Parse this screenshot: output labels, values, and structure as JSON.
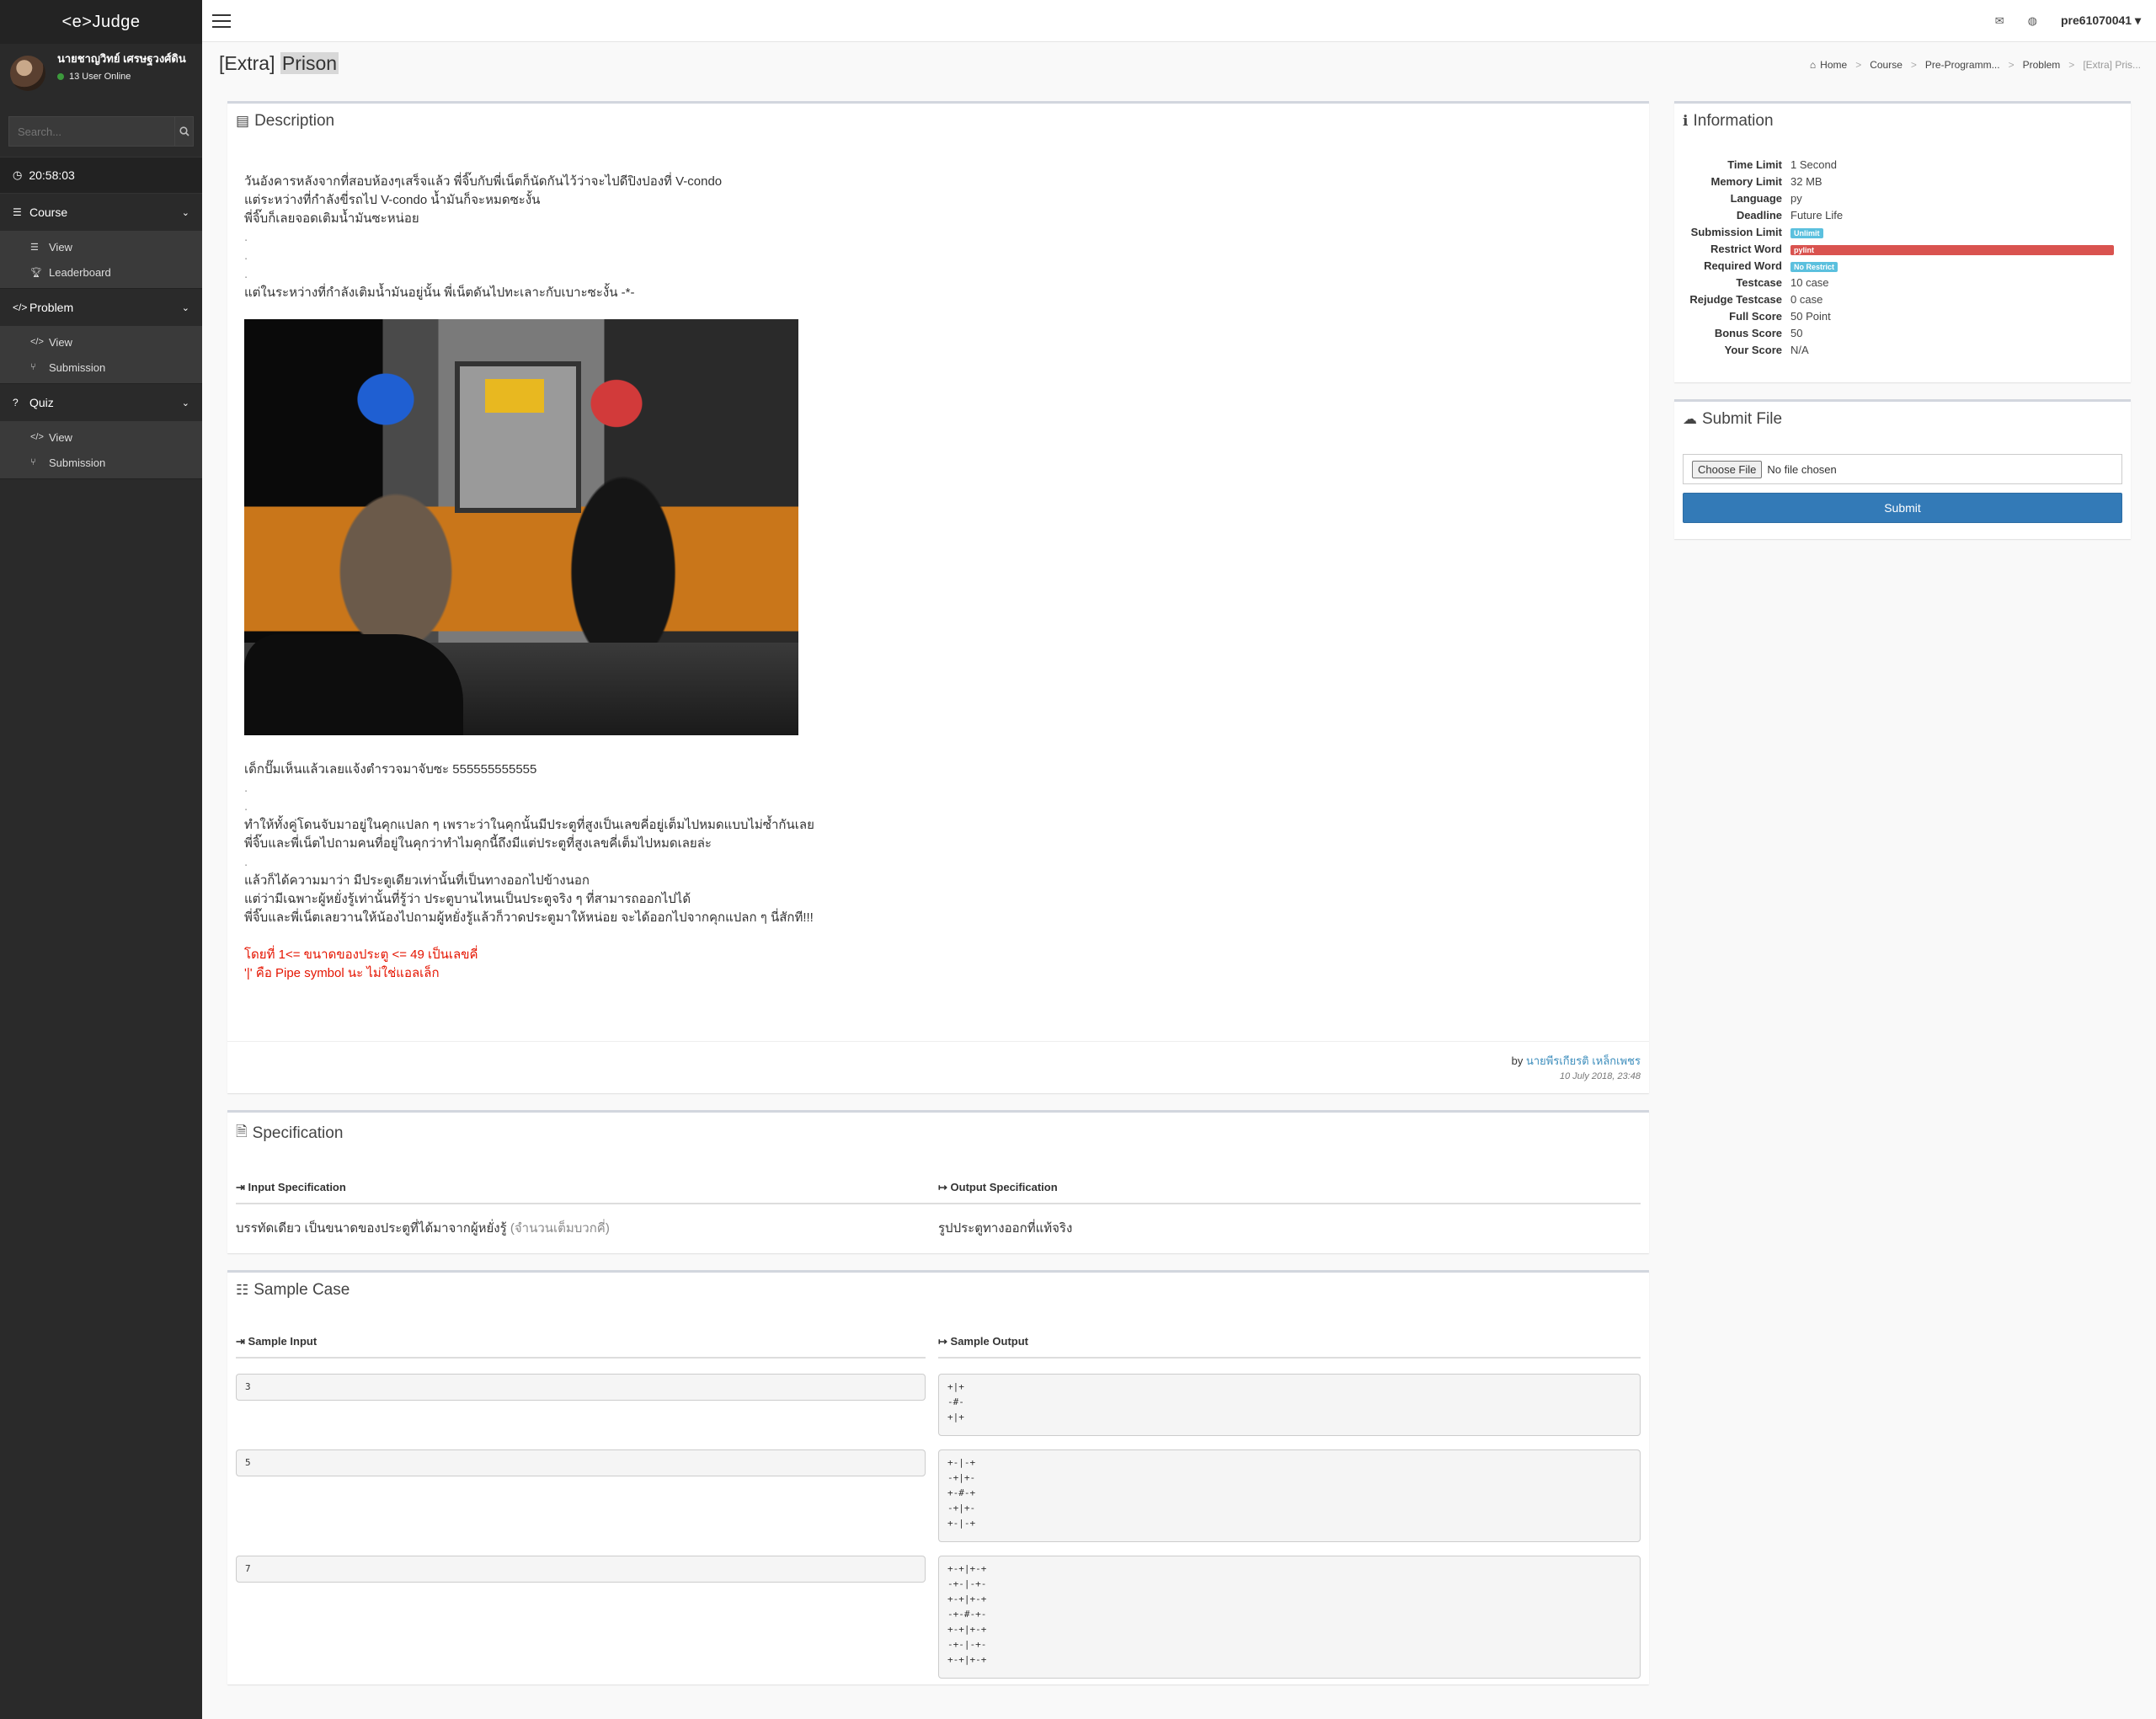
{
  "brand": "<e>Judge",
  "user": {
    "name": "นายชาญวิทย์ เศรษฐวงศ์ดิน",
    "online": "13 User Online"
  },
  "search": {
    "placeholder": "Search..."
  },
  "clock": "20:58:03",
  "menu": {
    "course": {
      "label": "Course",
      "items": [
        "View",
        "Leaderboard"
      ]
    },
    "problem": {
      "label": "Problem",
      "items": [
        "View",
        "Submission"
      ]
    },
    "quiz": {
      "label": "Quiz",
      "items": [
        "View",
        "Submission"
      ]
    }
  },
  "topbar": {
    "username": "pre61070041"
  },
  "page": {
    "title_prefix": "[Extra]",
    "title_main": "Prison"
  },
  "breadcrumb": [
    "Home",
    "Course",
    "Pre-Programm...",
    "Problem",
    "[Extra] Pris..."
  ],
  "description": {
    "title": "Description",
    "lines1": [
      "วันอังคารหลังจากที่สอบห้องๆเสร็จแล้ว พี่จิ๊บกับพี่เน็ตก็นัดกันไว้ว่าจะไปดีปิงปองที่ V-condo",
      "แต่ระหว่างที่กำลังขี่รถไป V-condo น้ำมันก็จะหมดซะงั้น",
      "พี่จิ๊บก็เลยจอดเติมน้ำมันซะหน่อย"
    ],
    "line2": "แต่ในระหว่างที่กำลังเติมน้ำมันอยู่นั้น   พี่เน็ตดันไปทะเลาะกับเบาะซะงั้น -*-",
    "line3": "เด็กปั๊มเห็นแล้วเลยแจ้งตำรวจมาจับซะ 555555555555",
    "lines4": [
      "ทำให้ทั้งคู่โดนจับมาอยู่ในคุกแปลก ๆ เพราะว่าในคุกนั้นมีประตูที่สูงเป็นเลขคี่อยู่เต็มไปหมดแบบไม่ซ้ำกันเลย",
      "พี่จิ๊บและพี่เน็ตไปถามคนที่อยู่ในคุกว่าทำไมคุกนี้ถึงมีแต่ประตูที่สูงเลขคี่เต็มไปหมดเลยล่ะ"
    ],
    "lines5": [
      "แล้วก็ได้ความมาว่า มีประตูเดียวเท่านั้นที่เป็นทางออกไปข้างนอก",
      "แต่ว่ามีเฉพาะผู้หยั่งรู้เท่านั้นที่รู้ว่า ประตูบานไหนเป็นประตูจริง ๆ ที่สามารถออกไปได้",
      "พี่จิ๊บและพี่เน็ตเลยวานให้น้องไปถามผู้หยั่งรู้แล้วก็วาดประตูมาให้หน่อย จะได้ออกไปจากคุกแปลก ๆ นี่สักที!!!"
    ],
    "red1": "โดยที่  1<= ขนาดของประตู <= 49  เป็นเลขคี่",
    "red2": "'|'  คือ  Pipe symbol นะ  ไม่ใช่แอลเล็ก",
    "by_prefix": "by",
    "author": "นายพีรเกียรติ เหล็กเพชร",
    "date": "10 July 2018, 23:48"
  },
  "specification": {
    "title": "Specification",
    "input_head": "Input Specification",
    "output_head": "Output Specification",
    "input_text": "บรรทัดเดียว เป็นขนาดของประตูที่ได้มาจากผู้หยั่งรู้",
    "input_note": "(จำนวนเต็มบวกคี่)",
    "output_text": "รูปประตูทางออกที่แท้จริง"
  },
  "sample": {
    "title": "Sample Case",
    "input_head": "Sample Input",
    "output_head": "Sample Output",
    "cases": [
      {
        "input": "3",
        "output": "+|+\n-#-\n+|+"
      },
      {
        "input": "5",
        "output": "+-|-+\n-+|+-\n+-#-+\n-+|+-\n+-|-+"
      },
      {
        "input": "7",
        "output": "+-+|+-+\n-+-|-+-\n+-+|+-+\n-+-#-+-\n+-+|+-+\n-+-|-+-\n+-+|+-+"
      }
    ]
  },
  "information": {
    "title": "Information",
    "rows": [
      {
        "k": "Time Limit",
        "v": "1 Second"
      },
      {
        "k": "Memory Limit",
        "v": "32 MB"
      },
      {
        "k": "Language",
        "v": "py"
      },
      {
        "k": "Deadline",
        "v": "Future Life"
      }
    ],
    "submission_limit_k": "Submission Limit",
    "submission_limit_v": "Unlimit",
    "restrict_word_k": "Restrict Word",
    "restrict_word_v": "pylint",
    "required_word_k": "Required Word",
    "required_word_v": "No Restrict",
    "rows2": [
      {
        "k": "Testcase",
        "v": "10 case"
      },
      {
        "k": "Rejudge Testcase",
        "v": "0 case"
      },
      {
        "k": "Full Score",
        "v": "50 Point"
      },
      {
        "k": "Bonus Score",
        "v": "50"
      },
      {
        "k": "Your Score",
        "v": "N/A"
      }
    ]
  },
  "submit_file": {
    "title": "Submit File",
    "choose": "Choose File",
    "no_file": "No file chosen",
    "submit": "Submit"
  },
  "colors": {
    "accent": "#337ab7",
    "danger": "#d9534f",
    "info": "#5bc0de",
    "red_text": "#e51400",
    "sidebar": "#2a2a2a"
  }
}
